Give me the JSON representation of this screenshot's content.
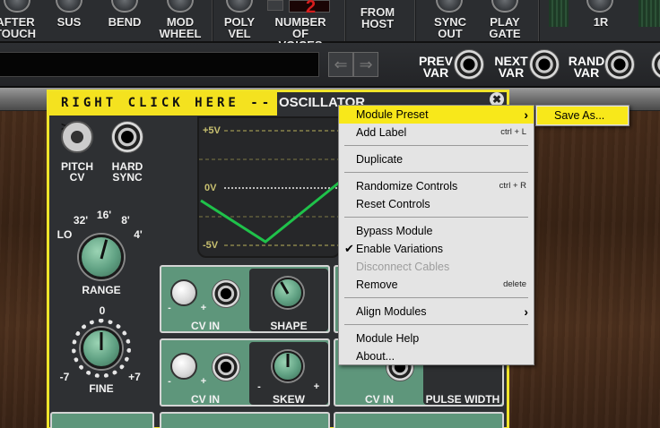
{
  "top_rack": {
    "labels": [
      "AFTER\nTOUCH",
      "SUS",
      "BEND",
      "MOD\nWHEEL",
      "POLY\nVEL",
      "NUMBER\nOF VOICES",
      "FROM\nHOST",
      "SYNC\nOUT",
      "PLAY\nGATE",
      "1R"
    ],
    "voice_display": "2"
  },
  "second_strip": {
    "prev_label": "PREV\nVAR",
    "next_label": "NEXT\nVAR",
    "rand_label": "RAND\nVAR",
    "prev_arrow": "⇐",
    "next_arrow": "⇒"
  },
  "module": {
    "banner": "RIGHT CLICK HERE -->",
    "title": "OSCILLATOR",
    "close_glyph": "✖",
    "pitch_cv_label": "PITCH\nCV",
    "hard_sync_label": "HARD\nSYNC",
    "range_label": "RANGE",
    "range_ticks": [
      "LO",
      "32'",
      "16'",
      "8'",
      "4'"
    ],
    "fine_label": "FINE",
    "fine_ticks": [
      "0",
      "-7",
      "+7"
    ],
    "scope_labels": [
      "+5V",
      "0V",
      "-5V"
    ],
    "cv_in_label": "CV IN",
    "shape_label": "SHAPE",
    "skew_label": "SKEW",
    "pulse_width_label": "PULSE WIDTH",
    "minus": "-",
    "plus": "+",
    "colors": {
      "accent": "#f4e21f",
      "panel_green": "#5e967b",
      "wave_green": "#1fc24a"
    }
  },
  "context_menu": {
    "items": [
      {
        "label": "Module Preset",
        "shortcut": "",
        "submenu": true,
        "highlight": true
      },
      {
        "label": "Add Label",
        "shortcut": "ctrl + L"
      },
      {
        "label": "Duplicate",
        "shortcut": ""
      },
      {
        "label": "Randomize Controls",
        "shortcut": "ctrl + R"
      },
      {
        "label": "Reset Controls",
        "shortcut": ""
      },
      {
        "label": "Bypass Module",
        "shortcut": ""
      },
      {
        "label": "Enable Variations",
        "shortcut": "",
        "checked": true
      },
      {
        "label": "Disconnect Cables",
        "shortcut": "",
        "disabled": true
      },
      {
        "label": "Remove",
        "shortcut": "delete"
      },
      {
        "label": "Align Modules",
        "shortcut": "",
        "submenu": true
      },
      {
        "label": "Module Help",
        "shortcut": ""
      },
      {
        "label": "About...",
        "shortcut": ""
      }
    ],
    "check_glyph": "✔",
    "arrow_glyph": "›",
    "submenu_item": "Save As..."
  }
}
